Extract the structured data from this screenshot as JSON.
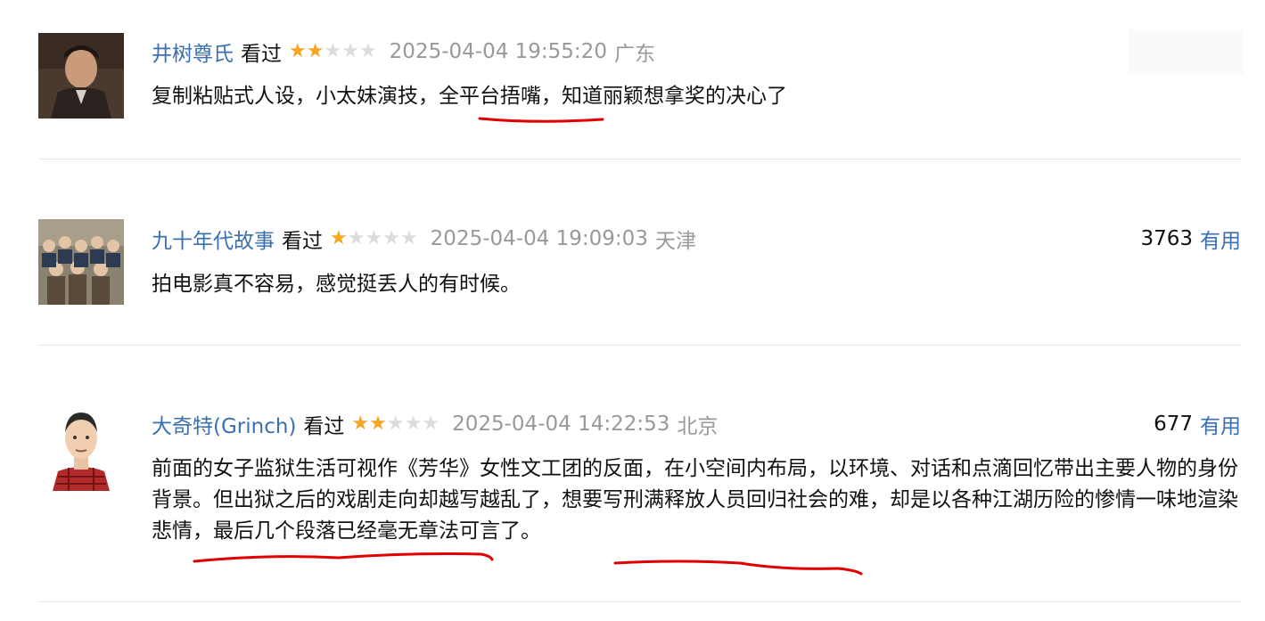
{
  "comments": [
    {
      "user": "井树尊氏",
      "status": "看过",
      "rating": 2,
      "time": "2025-04-04 19:55:20",
      "location": "广东",
      "votes": "",
      "useful_label": "",
      "text": "复制粘贴式人设，小太妹演技，全平台捂嘴，知道丽颖想拿奖的决心了"
    },
    {
      "user": "九十年代故事",
      "status": "看过",
      "rating": 1,
      "time": "2025-04-04 19:09:03",
      "location": "天津",
      "votes": "3763",
      "useful_label": "有用",
      "text": "拍电影真不容易，感觉挺丢人的有时候。"
    },
    {
      "user": "大奇特(Grinch)",
      "status": "看过",
      "rating": 2,
      "time": "2025-04-04 14:22:53",
      "location": "北京",
      "votes": "677",
      "useful_label": "有用",
      "text": "前面的女子监狱生活可视作《芳华》女性文工团的反面，在小空间内布局，以环境、对话和点滴回忆带出主要人物的身份背景。但出狱之后的戏剧走向却越写越乱了，想要写刑满释放人员回归社会的难，却是以各种江湖历险的惨情一味地渲染悲情，最后几个段落已经毫无章法可言了。"
    }
  ],
  "colors": {
    "username": "#3a6fb0",
    "star_on": "#f5a623",
    "star_off": "#dcdcdc",
    "meta_gray": "#999999",
    "annotation_red": "#e00000"
  },
  "icons": [
    "avatar-portrait",
    "avatar-group-photo",
    "avatar-cartoon-man",
    "star-icon"
  ]
}
